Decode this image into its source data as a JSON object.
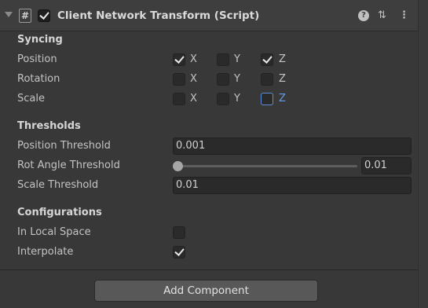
{
  "header": {
    "title": "Client Network Transform (Script)",
    "script_glyph": "#",
    "help_glyph": "?",
    "presets_glyph": "⇅",
    "menu_glyph": "⋮",
    "enabled": true
  },
  "sections": {
    "syncing": "Syncing",
    "thresholds": "Thresholds",
    "configurations": "Configurations"
  },
  "syncing": {
    "axes": {
      "x": "X",
      "y": "Y",
      "z": "Z"
    },
    "position": {
      "label": "Position",
      "x": true,
      "y": false,
      "z": true
    },
    "rotation": {
      "label": "Rotation",
      "x": false,
      "y": false,
      "z": false
    },
    "scale": {
      "label": "Scale",
      "x": false,
      "y": false,
      "z": false
    }
  },
  "thresholds": {
    "position": {
      "label": "Position Threshold",
      "value": "0.001"
    },
    "rot_angle": {
      "label": "Rot Angle Threshold",
      "value": "0.01"
    },
    "scale": {
      "label": "Scale Threshold",
      "value": "0.01"
    }
  },
  "configurations": {
    "in_local_space": {
      "label": "In Local Space",
      "checked": false
    },
    "interpolate": {
      "label": "Interpolate",
      "checked": true
    }
  },
  "add_component": "Add Component",
  "colors": {
    "background": "#383838",
    "header": "#3e3e3e",
    "field": "#2a2a2a",
    "focus_accent": "#5a8ed8",
    "button": "#585858"
  }
}
